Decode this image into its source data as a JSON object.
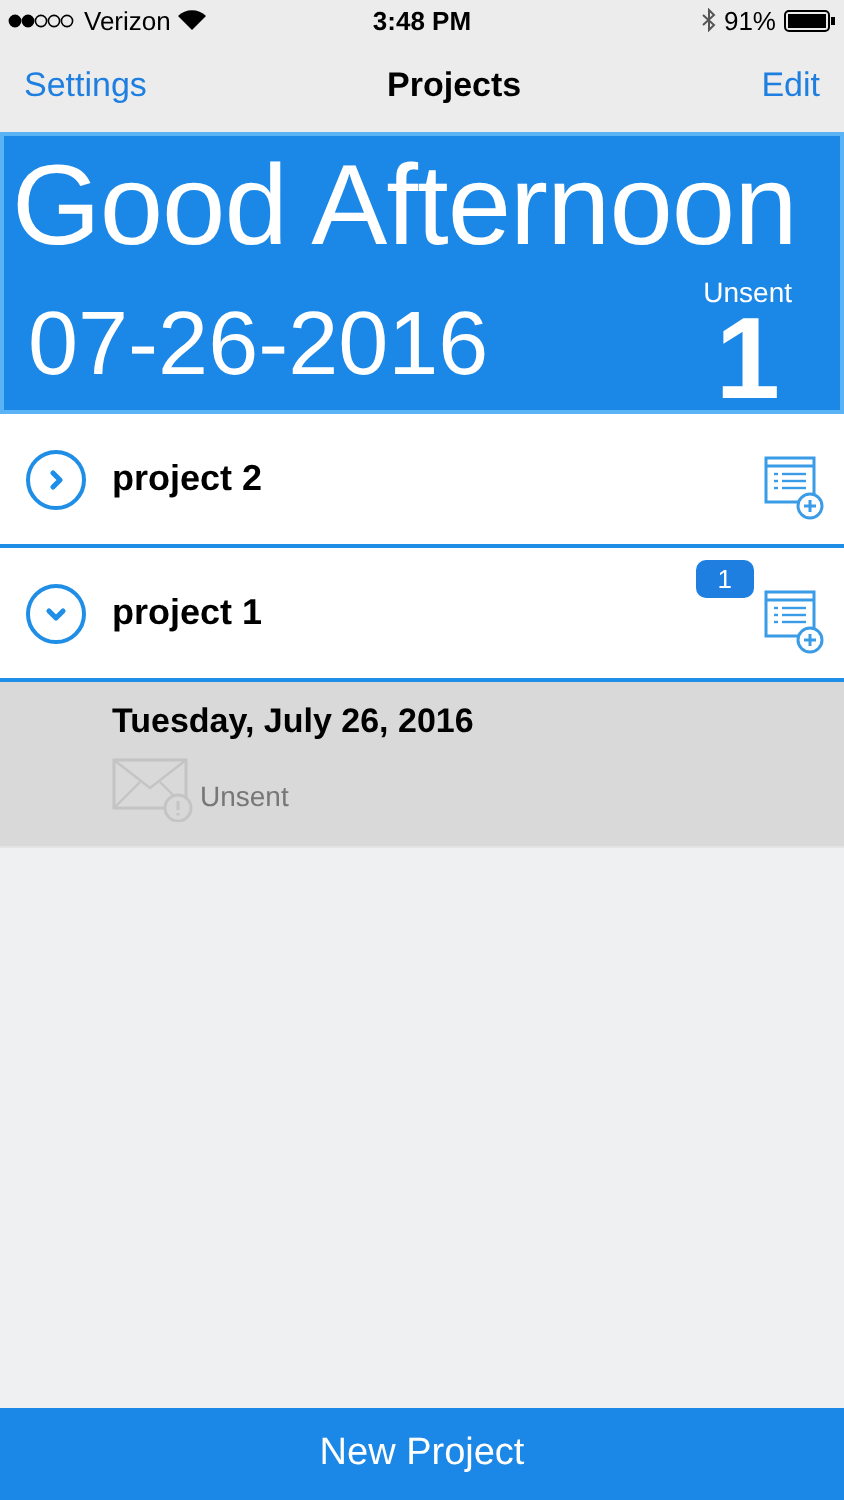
{
  "status_bar": {
    "carrier": "Verizon",
    "time": "3:48 PM",
    "battery": "91%"
  },
  "nav": {
    "left": "Settings",
    "title": "Projects",
    "right": "Edit"
  },
  "banner": {
    "greeting": "Good Afternoon",
    "date": "07-26-2016",
    "unsent_label": "Unsent",
    "unsent_count": "1"
  },
  "projects": [
    {
      "name": "project 2",
      "expanded": false
    },
    {
      "name": "project 1",
      "expanded": true,
      "badge": "1",
      "entries": [
        {
          "date": "Tuesday, July 26, 2016",
          "status": "Unsent"
        }
      ]
    }
  ],
  "bottom_button": "New Project"
}
